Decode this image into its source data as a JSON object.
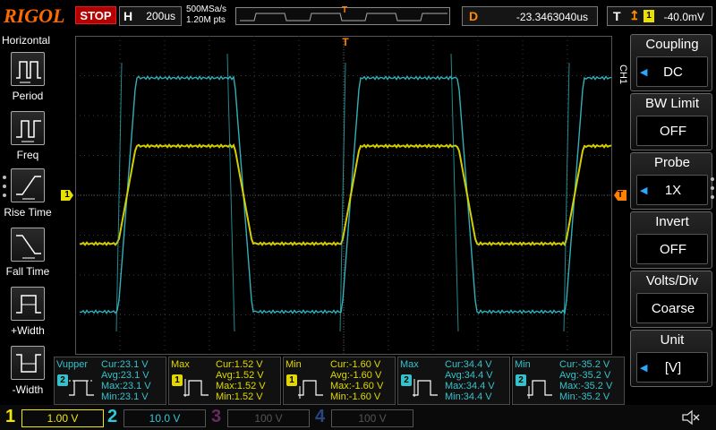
{
  "top": {
    "logo": "RIGOL",
    "run_state": "STOP",
    "h_label": "H",
    "timebase": "200us",
    "sample_rate": "500MSa/s",
    "mem_points": "1.20M pts",
    "trigger_pos_mark": "T",
    "d_label": "D",
    "delay": "-23.3463040us",
    "t_label": "T",
    "trigger_slope_symbol": "rising-edge",
    "trigger_channel": "1",
    "trigger_level": "-40.0mV"
  },
  "left": {
    "title": "Horizontal",
    "items": [
      {
        "label": "Period",
        "icon": "period-icon"
      },
      {
        "label": "Freq",
        "icon": "freq-icon"
      },
      {
        "label": "Rise Time",
        "icon": "rise-time-icon"
      },
      {
        "label": "Fall Time",
        "icon": "fall-time-icon"
      },
      {
        "label": "+Width",
        "icon": "plus-width-icon"
      },
      {
        "label": "-Width",
        "icon": "minus-width-icon"
      }
    ]
  },
  "markers": {
    "ch1": "1",
    "trigger_level": "T",
    "trigger_pos": "T"
  },
  "right": {
    "channel_tab": "CH1",
    "items": [
      {
        "title": "Coupling",
        "value": "DC"
      },
      {
        "title": "BW Limit",
        "value": "OFF"
      },
      {
        "title": "Probe",
        "value": "1X"
      },
      {
        "title": "Invert",
        "value": "OFF"
      },
      {
        "title": "Volts/Div",
        "value": "Coarse"
      },
      {
        "title": "Unit",
        "value": "[V]"
      }
    ]
  },
  "measurements": [
    {
      "name": "Vupper",
      "channel": "2",
      "cur": "Cur:23.1 V",
      "avg": "Avg:23.1 V",
      "max": "Max:23.1 V",
      "min": "Min:23.1 V"
    },
    {
      "name": "Max",
      "channel": "1",
      "cur": "Cur:1.52 V",
      "avg": "Avg:1.52 V",
      "max": "Max:1.52 V",
      "min": "Min:1.52 V"
    },
    {
      "name": "Min",
      "channel": "1",
      "cur": "Cur:-1.60 V",
      "avg": "Avg:-1.60 V",
      "max": "Max:-1.60 V",
      "min": "Min:-1.60 V"
    },
    {
      "name": "Max",
      "channel": "2",
      "cur": "Cur:34.4 V",
      "avg": "Avg:34.4 V",
      "max": "Max:34.4 V",
      "min": "Min:34.4 V"
    },
    {
      "name": "Min",
      "channel": "2",
      "cur": "Cur:-35.2 V",
      "avg": "Avg:-35.2 V",
      "max": "Max:-35.2 V",
      "min": "Min:-35.2 V"
    }
  ],
  "bottom": {
    "channels": [
      {
        "num": "1",
        "scale": "1.00 V",
        "color": "#f0e800"
      },
      {
        "num": "2",
        "scale": "10.0 V",
        "color": "#2ec8d8"
      },
      {
        "num": "3",
        "scale": "100 V",
        "color": "#a0308a"
      },
      {
        "num": "4",
        "scale": "100 V",
        "color": "#3060c0"
      }
    ]
  },
  "colors": {
    "ch1": "#e0d800",
    "ch2": "#36c2cc",
    "accent": "#ff7f00",
    "run_stop": "#b40000"
  }
}
